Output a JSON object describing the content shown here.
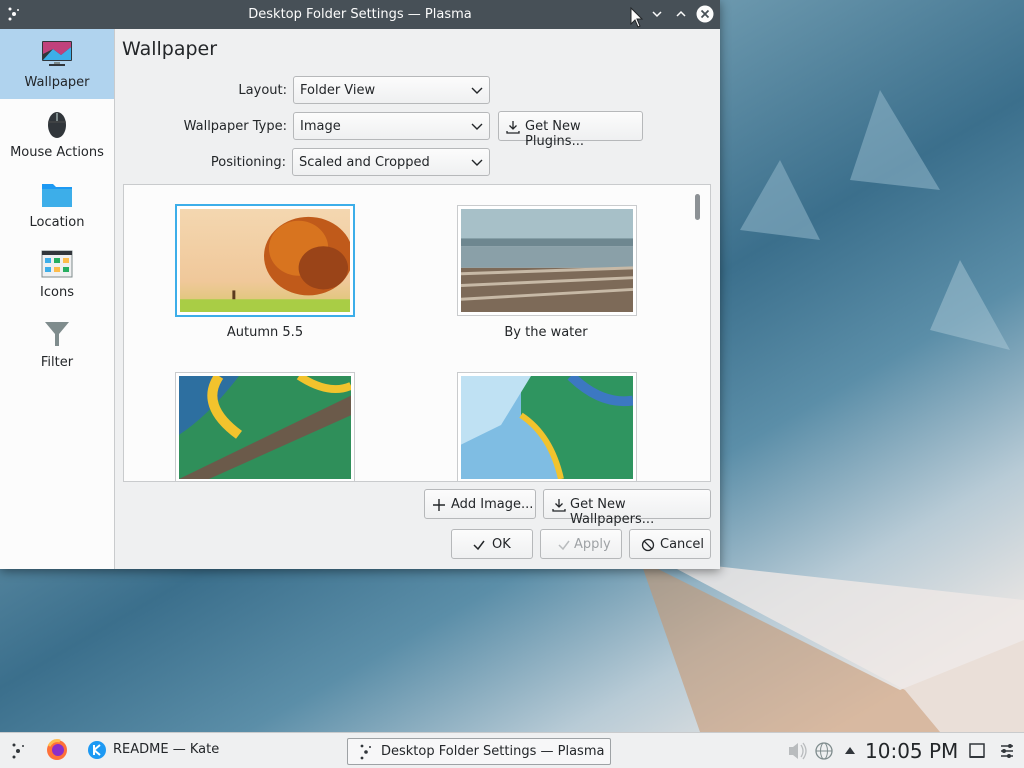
{
  "window": {
    "title": "Desktop Folder Settings — Plasma",
    "page_title": "Wallpaper"
  },
  "sidebar": {
    "items": [
      {
        "label": "Wallpaper",
        "icon": "monitor-wallpaper-icon",
        "active": true
      },
      {
        "label": "Mouse Actions",
        "icon": "mouse-icon",
        "active": false
      },
      {
        "label": "Location",
        "icon": "folder-icon",
        "active": false
      },
      {
        "label": "Icons",
        "icon": "icons-grid-icon",
        "active": false
      },
      {
        "label": "Filter",
        "icon": "filter-funnel-icon",
        "active": false
      }
    ]
  },
  "form": {
    "layout_label": "Layout:",
    "layout_value": "Folder View",
    "type_label": "Wallpaper Type:",
    "type_value": "Image",
    "get_plugins_label": "Get New Plugins...",
    "positioning_label": "Positioning:",
    "positioning_value": "Scaled and Cropped"
  },
  "wallpapers": [
    {
      "name": "Autumn 5.5",
      "selected": true
    },
    {
      "name": "By the water",
      "selected": false
    },
    {
      "name": "",
      "selected": false
    },
    {
      "name": "",
      "selected": false
    }
  ],
  "buttons": {
    "add_image": "Add Image...",
    "get_wallpapers": "Get New Wallpapers...",
    "ok": "OK",
    "apply": "Apply",
    "cancel": "Cancel"
  },
  "taskbar": {
    "tasks": [
      {
        "label": "README — Kate",
        "icon": "kate-icon"
      },
      {
        "label": "Desktop Folder Settings — Plasma",
        "icon": "plasma-icon",
        "active": true
      }
    ],
    "clock": "10:05 PM"
  },
  "colors": {
    "accent": "#3daee9",
    "selection": "#b0d3ee",
    "titlebar": "#475057"
  }
}
